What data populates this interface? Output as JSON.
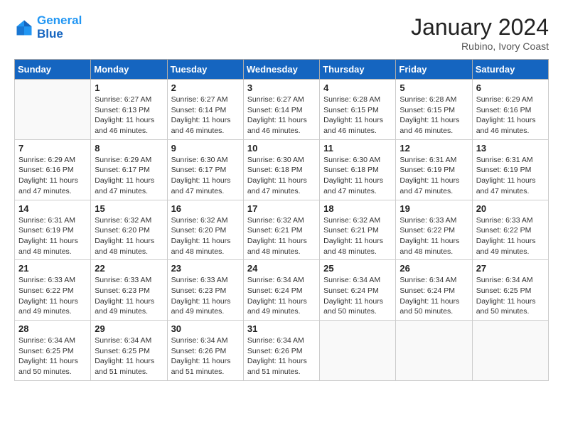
{
  "logo": {
    "line1": "General",
    "line2": "Blue"
  },
  "title": "January 2024",
  "subtitle": "Rubino, Ivory Coast",
  "days_header": [
    "Sunday",
    "Monday",
    "Tuesday",
    "Wednesday",
    "Thursday",
    "Friday",
    "Saturday"
  ],
  "weeks": [
    [
      {
        "day": "",
        "sunrise": "",
        "sunset": "",
        "daylight": ""
      },
      {
        "day": "1",
        "sunrise": "Sunrise: 6:27 AM",
        "sunset": "Sunset: 6:13 PM",
        "daylight": "Daylight: 11 hours and 46 minutes."
      },
      {
        "day": "2",
        "sunrise": "Sunrise: 6:27 AM",
        "sunset": "Sunset: 6:14 PM",
        "daylight": "Daylight: 11 hours and 46 minutes."
      },
      {
        "day": "3",
        "sunrise": "Sunrise: 6:27 AM",
        "sunset": "Sunset: 6:14 PM",
        "daylight": "Daylight: 11 hours and 46 minutes."
      },
      {
        "day": "4",
        "sunrise": "Sunrise: 6:28 AM",
        "sunset": "Sunset: 6:15 PM",
        "daylight": "Daylight: 11 hours and 46 minutes."
      },
      {
        "day": "5",
        "sunrise": "Sunrise: 6:28 AM",
        "sunset": "Sunset: 6:15 PM",
        "daylight": "Daylight: 11 hours and 46 minutes."
      },
      {
        "day": "6",
        "sunrise": "Sunrise: 6:29 AM",
        "sunset": "Sunset: 6:16 PM",
        "daylight": "Daylight: 11 hours and 46 minutes."
      }
    ],
    [
      {
        "day": "7",
        "sunrise": "Sunrise: 6:29 AM",
        "sunset": "Sunset: 6:16 PM",
        "daylight": "Daylight: 11 hours and 47 minutes."
      },
      {
        "day": "8",
        "sunrise": "Sunrise: 6:29 AM",
        "sunset": "Sunset: 6:17 PM",
        "daylight": "Daylight: 11 hours and 47 minutes."
      },
      {
        "day": "9",
        "sunrise": "Sunrise: 6:30 AM",
        "sunset": "Sunset: 6:17 PM",
        "daylight": "Daylight: 11 hours and 47 minutes."
      },
      {
        "day": "10",
        "sunrise": "Sunrise: 6:30 AM",
        "sunset": "Sunset: 6:18 PM",
        "daylight": "Daylight: 11 hours and 47 minutes."
      },
      {
        "day": "11",
        "sunrise": "Sunrise: 6:30 AM",
        "sunset": "Sunset: 6:18 PM",
        "daylight": "Daylight: 11 hours and 47 minutes."
      },
      {
        "day": "12",
        "sunrise": "Sunrise: 6:31 AM",
        "sunset": "Sunset: 6:19 PM",
        "daylight": "Daylight: 11 hours and 47 minutes."
      },
      {
        "day": "13",
        "sunrise": "Sunrise: 6:31 AM",
        "sunset": "Sunset: 6:19 PM",
        "daylight": "Daylight: 11 hours and 47 minutes."
      }
    ],
    [
      {
        "day": "14",
        "sunrise": "Sunrise: 6:31 AM",
        "sunset": "Sunset: 6:19 PM",
        "daylight": "Daylight: 11 hours and 48 minutes."
      },
      {
        "day": "15",
        "sunrise": "Sunrise: 6:32 AM",
        "sunset": "Sunset: 6:20 PM",
        "daylight": "Daylight: 11 hours and 48 minutes."
      },
      {
        "day": "16",
        "sunrise": "Sunrise: 6:32 AM",
        "sunset": "Sunset: 6:20 PM",
        "daylight": "Daylight: 11 hours and 48 minutes."
      },
      {
        "day": "17",
        "sunrise": "Sunrise: 6:32 AM",
        "sunset": "Sunset: 6:21 PM",
        "daylight": "Daylight: 11 hours and 48 minutes."
      },
      {
        "day": "18",
        "sunrise": "Sunrise: 6:32 AM",
        "sunset": "Sunset: 6:21 PM",
        "daylight": "Daylight: 11 hours and 48 minutes."
      },
      {
        "day": "19",
        "sunrise": "Sunrise: 6:33 AM",
        "sunset": "Sunset: 6:22 PM",
        "daylight": "Daylight: 11 hours and 48 minutes."
      },
      {
        "day": "20",
        "sunrise": "Sunrise: 6:33 AM",
        "sunset": "Sunset: 6:22 PM",
        "daylight": "Daylight: 11 hours and 49 minutes."
      }
    ],
    [
      {
        "day": "21",
        "sunrise": "Sunrise: 6:33 AM",
        "sunset": "Sunset: 6:22 PM",
        "daylight": "Daylight: 11 hours and 49 minutes."
      },
      {
        "day": "22",
        "sunrise": "Sunrise: 6:33 AM",
        "sunset": "Sunset: 6:23 PM",
        "daylight": "Daylight: 11 hours and 49 minutes."
      },
      {
        "day": "23",
        "sunrise": "Sunrise: 6:33 AM",
        "sunset": "Sunset: 6:23 PM",
        "daylight": "Daylight: 11 hours and 49 minutes."
      },
      {
        "day": "24",
        "sunrise": "Sunrise: 6:34 AM",
        "sunset": "Sunset: 6:24 PM",
        "daylight": "Daylight: 11 hours and 49 minutes."
      },
      {
        "day": "25",
        "sunrise": "Sunrise: 6:34 AM",
        "sunset": "Sunset: 6:24 PM",
        "daylight": "Daylight: 11 hours and 50 minutes."
      },
      {
        "day": "26",
        "sunrise": "Sunrise: 6:34 AM",
        "sunset": "Sunset: 6:24 PM",
        "daylight": "Daylight: 11 hours and 50 minutes."
      },
      {
        "day": "27",
        "sunrise": "Sunrise: 6:34 AM",
        "sunset": "Sunset: 6:25 PM",
        "daylight": "Daylight: 11 hours and 50 minutes."
      }
    ],
    [
      {
        "day": "28",
        "sunrise": "Sunrise: 6:34 AM",
        "sunset": "Sunset: 6:25 PM",
        "daylight": "Daylight: 11 hours and 50 minutes."
      },
      {
        "day": "29",
        "sunrise": "Sunrise: 6:34 AM",
        "sunset": "Sunset: 6:25 PM",
        "daylight": "Daylight: 11 hours and 51 minutes."
      },
      {
        "day": "30",
        "sunrise": "Sunrise: 6:34 AM",
        "sunset": "Sunset: 6:26 PM",
        "daylight": "Daylight: 11 hours and 51 minutes."
      },
      {
        "day": "31",
        "sunrise": "Sunrise: 6:34 AM",
        "sunset": "Sunset: 6:26 PM",
        "daylight": "Daylight: 11 hours and 51 minutes."
      },
      {
        "day": "",
        "sunrise": "",
        "sunset": "",
        "daylight": ""
      },
      {
        "day": "",
        "sunrise": "",
        "sunset": "",
        "daylight": ""
      },
      {
        "day": "",
        "sunrise": "",
        "sunset": "",
        "daylight": ""
      }
    ]
  ]
}
